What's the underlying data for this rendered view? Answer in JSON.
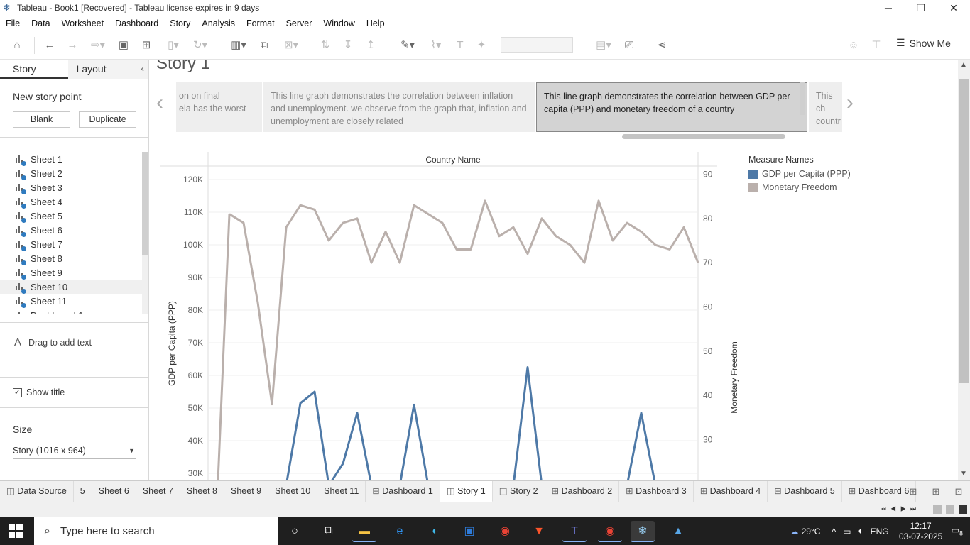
{
  "window": {
    "title": "Tableau - Book1 [Recovered] - Tableau license expires in 9 days",
    "minimize": "─",
    "restore": "❐",
    "close": "✕"
  },
  "menu": [
    "File",
    "Data",
    "Worksheet",
    "Dashboard",
    "Story",
    "Analysis",
    "Format",
    "Server",
    "Window",
    "Help"
  ],
  "toolbar": {
    "show_me": "Show Me"
  },
  "left_pane": {
    "tab_story": "Story",
    "tab_layout": "Layout",
    "collapse_icon": "‹",
    "new_story_point": "New story point",
    "blank_button": "Blank",
    "duplicate_button": "Duplicate",
    "sheets": [
      "Sheet 1",
      "Sheet 2",
      "Sheet 3",
      "Sheet 4",
      "Sheet 5",
      "Sheet 6",
      "Sheet 7",
      "Sheet 8",
      "Sheet 9",
      "Sheet 10",
      "Sheet 11",
      "Dashboard 1"
    ],
    "selected_sheet": "Sheet 10",
    "drag_text_icon": "A",
    "drag_text": "Drag to add text",
    "show_title": "Show title",
    "show_title_checked": true,
    "size_heading": "Size",
    "size_value": "Story (1016 x 964)"
  },
  "story": {
    "title": "Story 1",
    "points": [
      {
        "text": "on on final\nela has the worst",
        "active": false
      },
      {
        "text": "This line graph demonstrates the correlation between inflation and unemployment. we observe from the graph that, inflation and unemployment are closely related",
        "active": false
      },
      {
        "text": "This line graph demonstrates the correlation between GDP per capita (PPP) and monetary freedom of a country",
        "active": true
      },
      {
        "text": "This ch\ncountr",
        "active": false
      }
    ],
    "prev_icon": "‹",
    "next_icon": "›"
  },
  "chart_data": {
    "type": "line",
    "column_header": "Country Name",
    "ylabel_left": "GDP per Capita (PPP)",
    "ylabel_right": "Monetary Freedom",
    "left_ticks": [
      "120K",
      "110K",
      "100K",
      "90K",
      "80K",
      "70K",
      "60K",
      "50K",
      "40K",
      "30K"
    ],
    "right_ticks": [
      "90",
      "80",
      "70",
      "60",
      "50",
      "40",
      "30"
    ],
    "ylim_left": [
      28000,
      121000
    ],
    "ylim_right": [
      25,
      91
    ],
    "legend_title": "Measure Names",
    "series": [
      {
        "name": "GDP per Capita (PPP)",
        "color": "#4e79a7",
        "axis": "left",
        "values": [
          null,
          null,
          null,
          null,
          null,
          25000,
          51500,
          55000,
          25000,
          33000,
          48500,
          25000,
          25000,
          25000,
          51000,
          25000,
          25000,
          25000,
          25000,
          25000,
          25000,
          25000,
          62500,
          25000,
          25000,
          25000,
          25000,
          25000,
          25000,
          25000,
          48500,
          25000,
          25000,
          25000,
          25000
        ]
      },
      {
        "name": "Monetary Freedom",
        "color": "#bab0ac",
        "axis": "right",
        "values": [
          null,
          81,
          79,
          61,
          38,
          78,
          83,
          82,
          75,
          79,
          80,
          70,
          77,
          70,
          83,
          81,
          79,
          73,
          73,
          84,
          76,
          78,
          72,
          80,
          76,
          74,
          70,
          84,
          75,
          79,
          77,
          74,
          73,
          78,
          70
        ]
      }
    ]
  },
  "sheet_tabs": [
    "Data Source",
    "5",
    "Sheet 6",
    "Sheet 7",
    "Sheet 8",
    "Sheet 9",
    "Sheet 10",
    "Sheet 11",
    "Dashboard 1",
    "Story 1",
    "Story 2",
    "Dashboard 2",
    "Dashboard 3",
    "Dashboard 4",
    "Dashboard 5",
    "Dashboard 6"
  ],
  "active_tab": "Story 1",
  "taskbar": {
    "search_placeholder": "Type here to search",
    "weather": "29°C",
    "language": "ENG",
    "time": "12:17",
    "date": "03-07-2025",
    "notifications": "8"
  }
}
